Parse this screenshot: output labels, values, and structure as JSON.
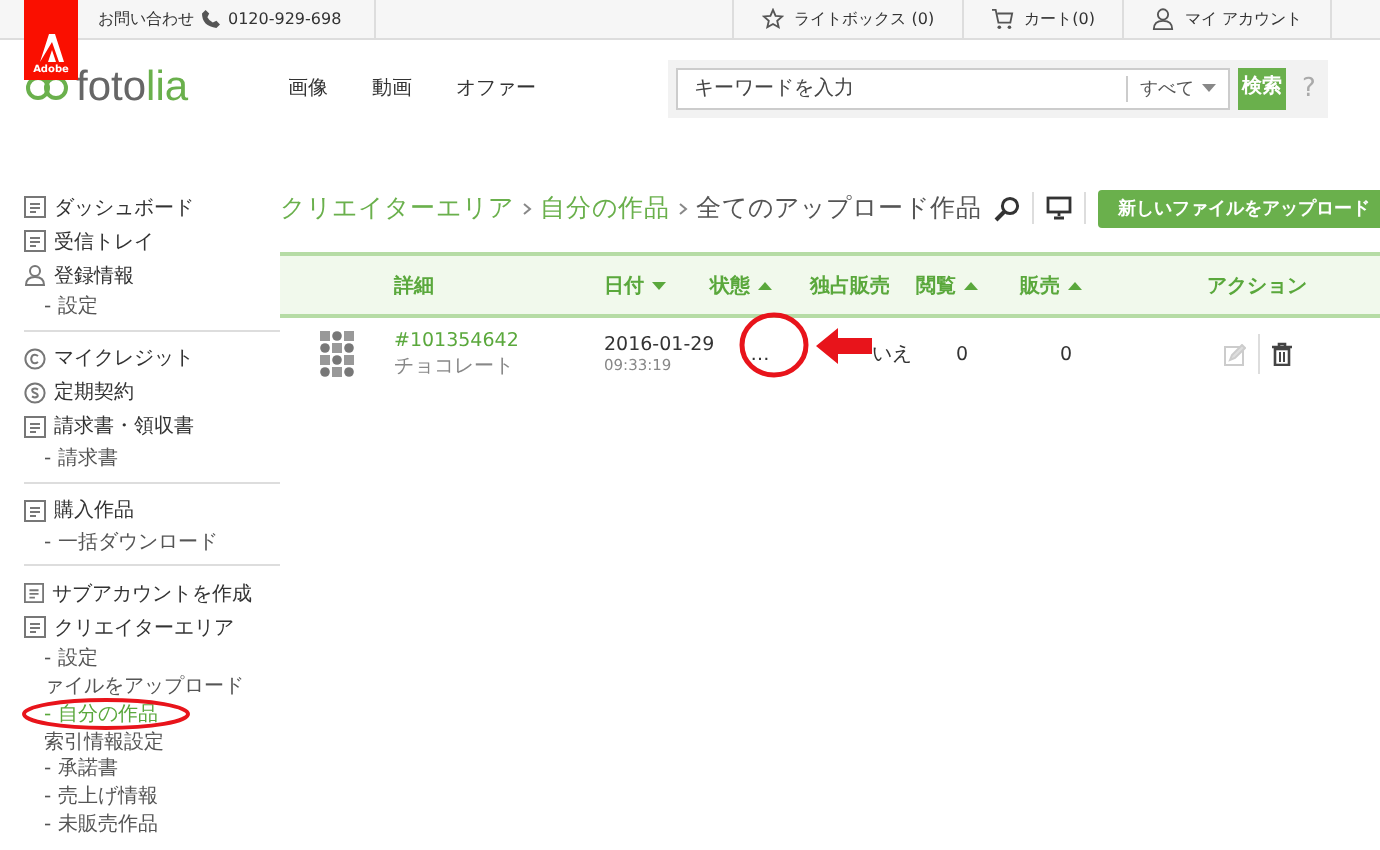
{
  "topbar": {
    "contact": "お問い合わせ",
    "phone": "0120-929-698",
    "links": [
      {
        "label": "ライトボックス (0)"
      },
      {
        "label": "カート(0)"
      },
      {
        "label": "マイ アカウント"
      }
    ]
  },
  "header": {
    "brand_badge": "Adobe",
    "logo_left": "foto",
    "logo_right": "lia",
    "nav": [
      "画像",
      "動画",
      "オファー"
    ],
    "search": {
      "placeholder": "キーワードを入力",
      "scope": "すべて",
      "button": "検索",
      "help": "?"
    }
  },
  "sidebar": {
    "groups": [
      {
        "items": [
          {
            "label": "ダッシュボード",
            "kind": "main",
            "selected": false
          },
          {
            "label": "受信トレイ",
            "kind": "main",
            "selected": false
          },
          {
            "label": "登録情報",
            "kind": "main",
            "selected": false
          },
          {
            "label": "- 設定",
            "kind": "sub",
            "selected": false
          }
        ]
      },
      {
        "items": [
          {
            "label": "マイクレジット",
            "kind": "main",
            "selected": false
          },
          {
            "label": "定期契約",
            "kind": "main",
            "selected": false
          },
          {
            "label": "請求書・領収書",
            "kind": "main",
            "selected": false
          },
          {
            "label": "- 請求書",
            "kind": "sub",
            "selected": false
          }
        ]
      },
      {
        "items": [
          {
            "label": "購入作品",
            "kind": "main",
            "selected": false
          },
          {
            "label": "- 一括ダウンロード",
            "kind": "sub",
            "selected": false
          }
        ]
      },
      {
        "items": [
          {
            "label": "サブアカウントを作成",
            "kind": "main",
            "selected": false
          },
          {
            "label": "クリエイターエリア",
            "kind": "main",
            "selected": false
          },
          {
            "label": "- 設定",
            "kind": "sub",
            "selected": false
          },
          {
            "label": "ァイルをアップロード",
            "kind": "sub",
            "selected": false
          },
          {
            "label": "- 自分の作品",
            "kind": "sub",
            "selected": true
          },
          {
            "label": "索引情報設定",
            "kind": "sub",
            "selected": false
          },
          {
            "label": "- 承諾書",
            "kind": "sub",
            "selected": false
          },
          {
            "label": "- 売上げ情報",
            "kind": "sub",
            "selected": false
          },
          {
            "label": "- 未販売作品",
            "kind": "sub",
            "selected": false
          }
        ]
      }
    ]
  },
  "breadcrumb": [
    {
      "label": "クリエイターエリア",
      "kind": "link"
    },
    {
      "label": "自分の作品",
      "kind": "link"
    },
    {
      "label": "全てのアップロード作品",
      "kind": "current"
    }
  ],
  "upload_button": "新しいファイルをアップロード",
  "table": {
    "columns": [
      {
        "label": "詳細",
        "sorted": false
      },
      {
        "label": "日付",
        "sorted": true,
        "descending": true
      },
      {
        "label": "状態",
        "sorted": true,
        "descending": false
      },
      {
        "label": "独占販売",
        "sorted": false
      },
      {
        "label": "閲覧",
        "sorted": true,
        "descending": false
      },
      {
        "label": "販売",
        "sorted": true,
        "descending": false
      },
      {
        "label": "アクション",
        "sorted": false
      }
    ],
    "rows": [
      {
        "id": "#101354642",
        "title": "チョコレート",
        "date": "2016-01-29",
        "time": "09:33:19",
        "status": "…",
        "exclusive": "いえ",
        "views": "0",
        "sales": "0"
      }
    ]
  }
}
